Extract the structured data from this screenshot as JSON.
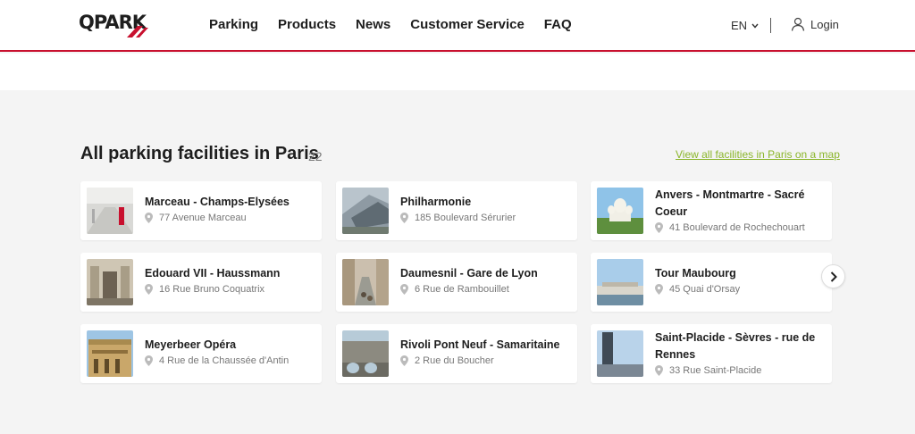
{
  "header": {
    "logo_text": "QPARK",
    "nav": [
      "Parking",
      "Products",
      "News",
      "Customer Service",
      "FAQ"
    ],
    "language": "EN",
    "login_label": "Login"
  },
  "section": {
    "title": "All parking facilities in Paris",
    "count": "22",
    "map_link": "View all facilities in Paris on a map"
  },
  "facilities": [
    {
      "name": "Marceau - Champs-Elysées",
      "address": "77 Avenue Marceau"
    },
    {
      "name": "Philharmonie",
      "address": "185 Boulevard Sérurier"
    },
    {
      "name": "Anvers - Montmartre - Sacré Coeur",
      "address": "41 Boulevard de Rochechouart"
    },
    {
      "name": "Edouard VII - Haussmann",
      "address": "16 Rue Bruno Coquatrix"
    },
    {
      "name": "Daumesnil - Gare de Lyon",
      "address": "6 Rue de Rambouillet"
    },
    {
      "name": "Tour Maubourg",
      "address": "45 Quai d'Orsay"
    },
    {
      "name": "Meyerbeer Opéra",
      "address": "4 Rue de la Chaussée d'Antin"
    },
    {
      "name": "Rivoli Pont Neuf - Samaritaine",
      "address": "2 Rue du Boucher"
    },
    {
      "name": "Saint-Placide - Sèvres - rue de Rennes",
      "address": "33 Rue Saint-Placide"
    }
  ],
  "icons": {
    "pin": "map-pin-icon",
    "next": "chevron-right-icon",
    "user": "user-icon",
    "lang": "chevron-down-icon"
  },
  "colors": {
    "brand_red": "#c8102e",
    "link_green": "#8ab52a"
  }
}
